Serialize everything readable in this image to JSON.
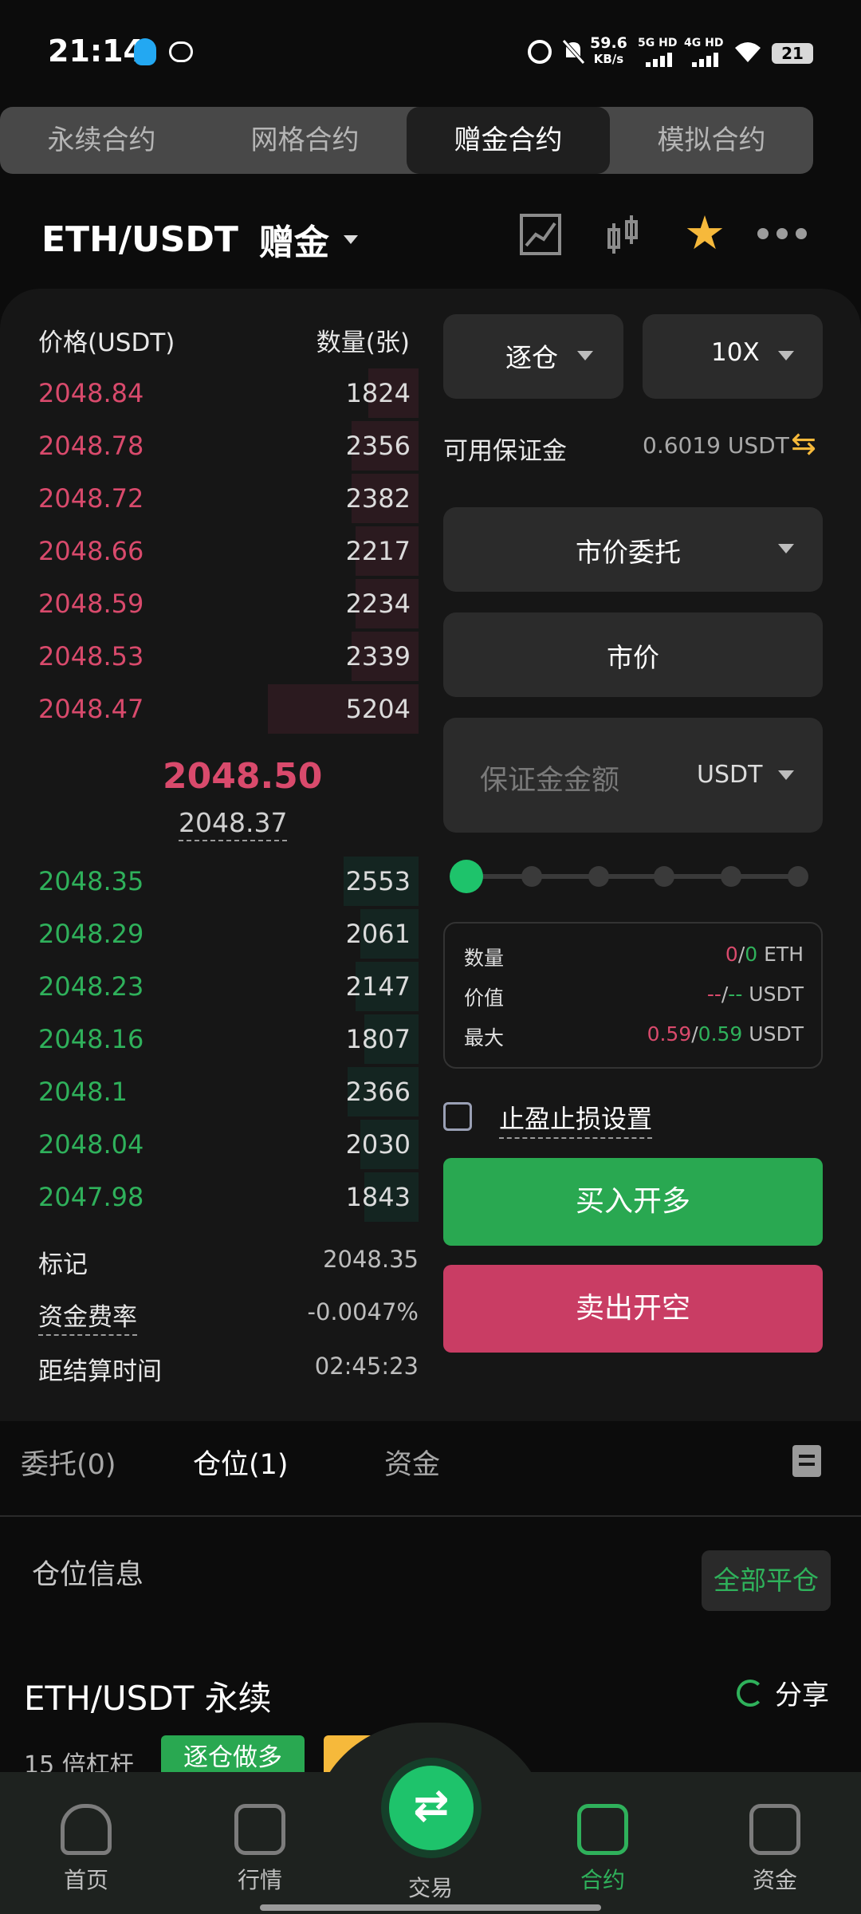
{
  "status_bar": {
    "time": "21:14",
    "net_speed": "59.6",
    "net_unit": "KB/s",
    "sig1": "5G HD",
    "sig2": "4G HD",
    "battery": "21"
  },
  "top_tabs": [
    "永续合约",
    "网格合约",
    "赠金合约",
    "模拟合约"
  ],
  "active_tab": 2,
  "pair": {
    "symbol": "ETH/USDT",
    "mode": "赠金"
  },
  "order_book": {
    "price_header": "价格(USDT)",
    "qty_header": "数量(张)",
    "asks": [
      {
        "price": "2048.84",
        "qty": "1824",
        "depth": 0.12
      },
      {
        "price": "2048.78",
        "qty": "2356",
        "depth": 0.16
      },
      {
        "price": "2048.72",
        "qty": "2382",
        "depth": 0.16
      },
      {
        "price": "2048.66",
        "qty": "2217",
        "depth": 0.15
      },
      {
        "price": "2048.59",
        "qty": "2234",
        "depth": 0.15
      },
      {
        "price": "2048.53",
        "qty": "2339",
        "depth": 0.16
      },
      {
        "price": "2048.47",
        "qty": "5204",
        "depth": 0.36
      }
    ],
    "last_price": "2048.50",
    "mark_price": "2048.37",
    "bids": [
      {
        "price": "2048.35",
        "qty": "2553",
        "depth": 0.18
      },
      {
        "price": "2048.29",
        "qty": "2061",
        "depth": 0.14
      },
      {
        "price": "2048.23",
        "qty": "2147",
        "depth": 0.15
      },
      {
        "price": "2048.16",
        "qty": "1807",
        "depth": 0.13
      },
      {
        "price": "2048.1",
        "qty": "2366",
        "depth": 0.17
      },
      {
        "price": "2048.04",
        "qty": "2030",
        "depth": 0.14
      },
      {
        "price": "2047.98",
        "qty": "1843",
        "depth": 0.13
      }
    ]
  },
  "market_info": {
    "mark_label": "标记",
    "mark_value": "2048.35",
    "funding_label": "资金费率",
    "funding_value": "-0.0047%",
    "settle_label": "距结算时间",
    "settle_value": "02:45:23"
  },
  "form": {
    "margin_mode": "逐仓",
    "leverage": "10X",
    "avail_label": "可用保证金",
    "avail_value": "0.6019 USDT",
    "order_type": "市价委托",
    "price_field": "市价",
    "amount_placeholder": "保证金金额",
    "amount_unit": "USDT",
    "slider_level": 0,
    "summary": {
      "qty_label": "数量",
      "qty_long": "0",
      "qty_short": "0",
      "qty_unit": "ETH",
      "value_label": "价值",
      "value_long": "--",
      "value_short": "--",
      "value_unit": "USDT",
      "max_label": "最大",
      "max_long": "0.59",
      "max_short": "0.59",
      "max_unit": "USDT"
    },
    "tpsl_label": "止盈止损设置",
    "buy_label": "买入开多",
    "sell_label": "卖出开空"
  },
  "lower_tabs": [
    "委托(0)",
    "仓位(1)",
    "资金"
  ],
  "position": {
    "section_title": "仓位信息",
    "close_all": "全部平仓",
    "name": "ETH/USDT 永续",
    "share": "分享",
    "leverage": "15 倍杠杆",
    "tag": "逐仓做多"
  },
  "bottom_nav": [
    "首页",
    "行情",
    "交易",
    "合约",
    "资金"
  ],
  "colors": {
    "ask": "#d94a6c",
    "bid": "#2fb15b",
    "accent": "#1ec36b",
    "star": "#f6b93b"
  }
}
